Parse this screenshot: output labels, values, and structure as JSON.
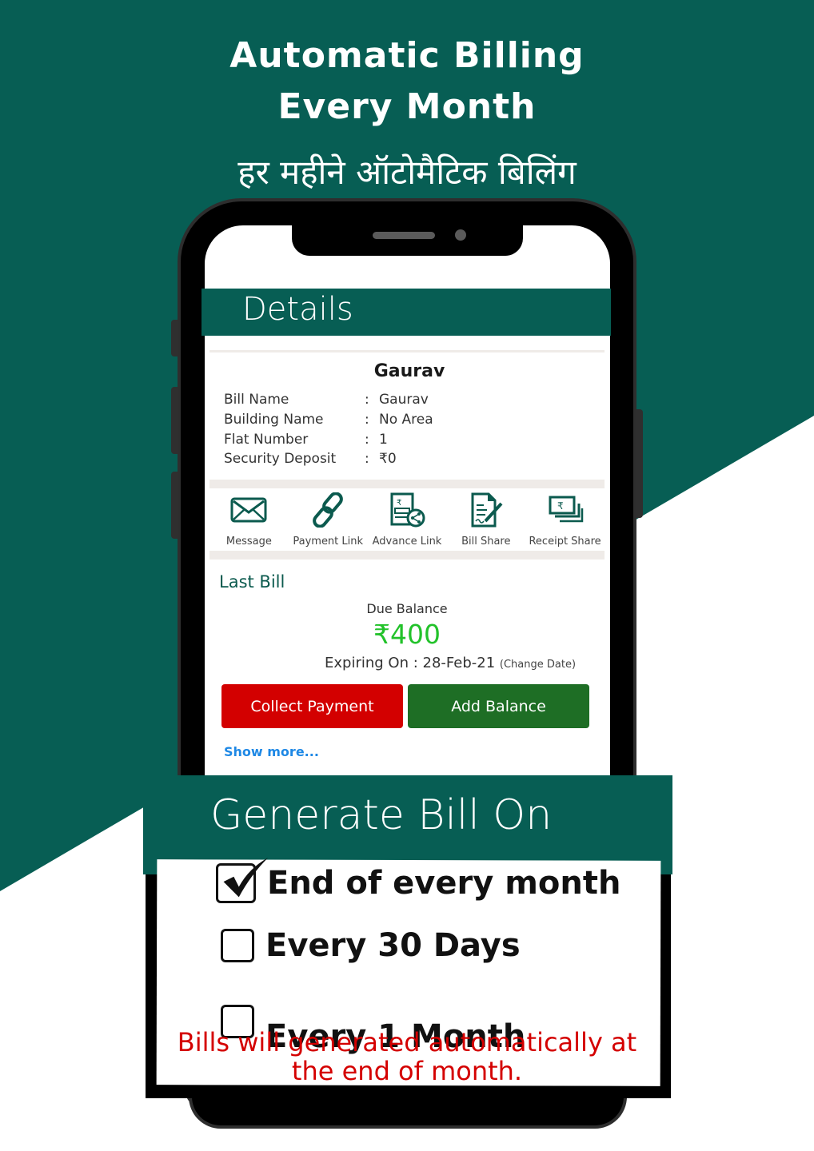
{
  "colors": {
    "brand_green": "#075e54",
    "collect_red": "#d30000",
    "add_green": "#1e6e25",
    "amount_green": "#22c22a",
    "link_blue": "#1e88e5",
    "note_red": "#d40000"
  },
  "headline": {
    "line1": "Automatic Billing",
    "line2": "Every Month",
    "hindi": "हर महीने ऑटोमैटिक बिलिंग"
  },
  "app": {
    "header_title": "Details",
    "customer_name": "Gaurav",
    "fields": [
      {
        "label": "Bill Name",
        "value": "Gaurav"
      },
      {
        "label": "Building Name",
        "value": "No Area"
      },
      {
        "label": "Flat Number",
        "value": "1"
      },
      {
        "label": "Security Deposit",
        "value": "₹0"
      }
    ],
    "actions": [
      {
        "label": "Message",
        "icon": "envelope-icon"
      },
      {
        "label": "Payment Link",
        "icon": "link-icon"
      },
      {
        "label": "Advance Link",
        "icon": "advance-link-icon"
      },
      {
        "label": "Bill Share",
        "icon": "bill-share-icon"
      },
      {
        "label": "Receipt Share",
        "icon": "receipt-share-icon"
      }
    ],
    "last_bill": {
      "title": "Last Bill",
      "due_label": "Due Balance",
      "due_amount": "₹400",
      "expiry_label": "Expiring On : 28-Feb-21",
      "change_date": "(Change Date)"
    },
    "buttons": {
      "collect": "Collect Payment",
      "add_balance": "Add Balance"
    },
    "show_more": "Show more..."
  },
  "generate": {
    "title": "Generate Bill On",
    "options": [
      {
        "label": "End of every month",
        "checked": true
      },
      {
        "label": "Every 30 Days",
        "checked": false
      },
      {
        "label": "Every 1 Month",
        "checked": false
      }
    ],
    "note": "Bills will generated automatically at the end of month."
  }
}
